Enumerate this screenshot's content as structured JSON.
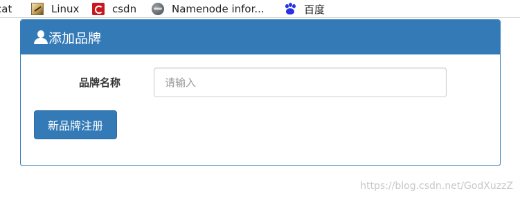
{
  "bookmarks": [
    {
      "label": "cat",
      "icon": "none"
    },
    {
      "label": "Linux",
      "icon": "linux-icon"
    },
    {
      "label": "csdn",
      "icon": "csdn-icon"
    },
    {
      "label": "Namenode infor...",
      "icon": "globe-icon"
    },
    {
      "label": "百度",
      "icon": "baidu-icon"
    }
  ],
  "panel": {
    "title": "添加品牌",
    "title_icon": "user-icon",
    "accent_color": "#337ab7"
  },
  "form": {
    "brand_label": "品牌名称",
    "brand_input_value": "",
    "brand_input_placeholder": "请输入",
    "register_button_label": "新品牌注册"
  },
  "watermark": "https://blog.csdn.net/GodXuzzZ"
}
